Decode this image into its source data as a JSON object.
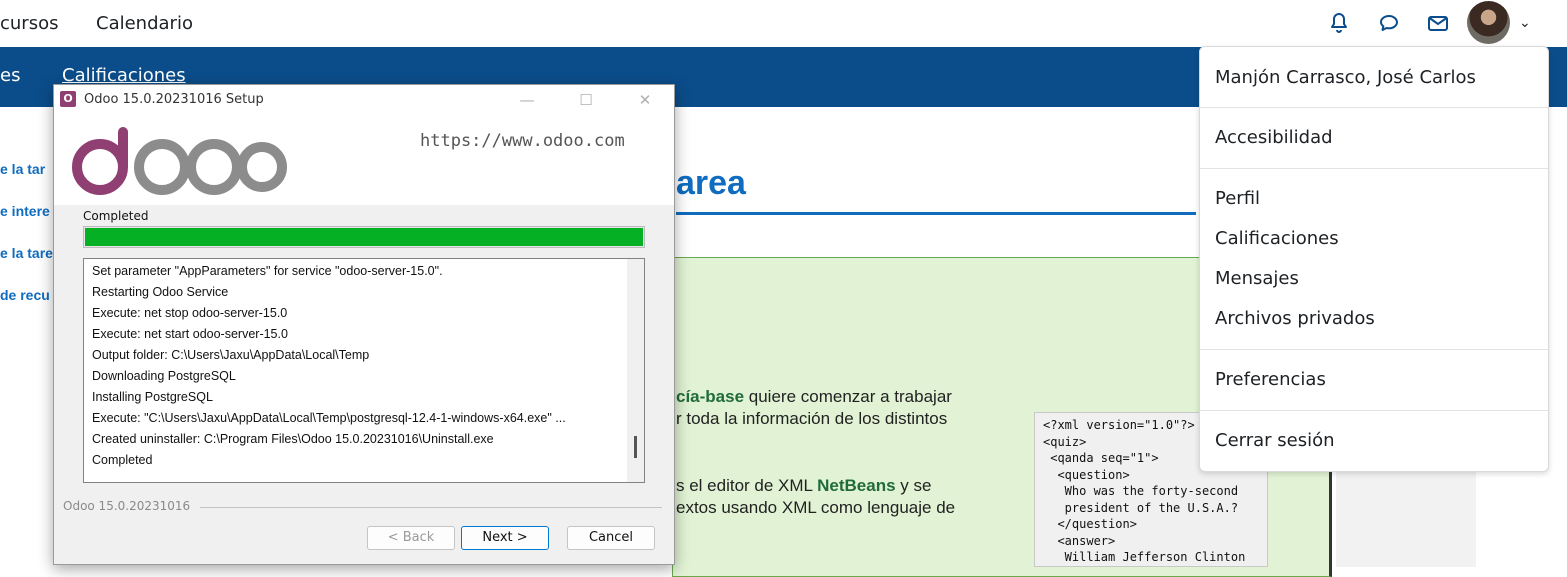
{
  "topnav": {
    "links": [
      "cursos",
      "Calendario"
    ],
    "icons": [
      "bell-icon",
      "chat-icon",
      "mail-icon"
    ]
  },
  "bluebar": {
    "tab_partial": "es",
    "tab_label": "Calificaciones"
  },
  "sidebar": {
    "items": [
      "e la tar",
      "e intere",
      "e la tare",
      "de recu"
    ]
  },
  "content": {
    "heading_partial": "area",
    "para1_line1_pre": "cía-base",
    "para1_line1_post": " quiere comenzar a trabajar",
    "para1_line2": "r toda la información de los distintos",
    "para2_line1_pre": "s el editor de XML ",
    "para2_line1_bold": "NetBeans",
    "para2_line1_post": " y se",
    "para2_line2": "extos usando XML como lenguaje de",
    "xml_sample": "<?xml version=\"1.0\"?>\n<quiz>\n <qanda seq=\"1\">\n  <question>\n   Who was the forty-second\n   president of the U.S.A.?\n  </question>\n  <answer>\n   William Jefferson Clinton"
  },
  "user_menu": {
    "items": [
      "Manjón Carrasco, José Carlos",
      "Accesibilidad",
      "Perfil",
      "Calificaciones",
      "Mensajes",
      "Archivos privados",
      "Preferencias",
      "Cerrar sesión"
    ]
  },
  "setup": {
    "title": "Odoo 15.0.20231016 Setup",
    "url": "https://www.odoo.com",
    "status": "Completed",
    "progress": 1.0,
    "log": [
      "Set parameter \"AppParameters\" for service \"odoo-server-15.0\".",
      "Restarting Odoo Service",
      "Execute: net stop odoo-server-15.0",
      "Execute: net start odoo-server-15.0",
      "Output folder: C:\\Users\\Jaxu\\AppData\\Local\\Temp",
      "Downloading PostgreSQL",
      "Installing PostgreSQL",
      "Execute: \"C:\\Users\\Jaxu\\AppData\\Local\\Temp\\postgresql-12.4-1-windows-x64.exe\" ...",
      "Created uninstaller: C:\\Program Files\\Odoo 15.0.20231016\\Uninstall.exe",
      "Completed"
    ],
    "footer": "Odoo 15.0.20231016",
    "buttons": {
      "back": "< Back",
      "next": "Next >",
      "cancel": "Cancel"
    },
    "window_controls": {
      "minimize": "—",
      "maximize": "☐",
      "close": "✕"
    }
  },
  "colors": {
    "brand_blue": "#0b4d8a",
    "link_blue": "#0f6cbf",
    "progress_green": "#06b025",
    "odoo_purple": "#8f3f71"
  }
}
